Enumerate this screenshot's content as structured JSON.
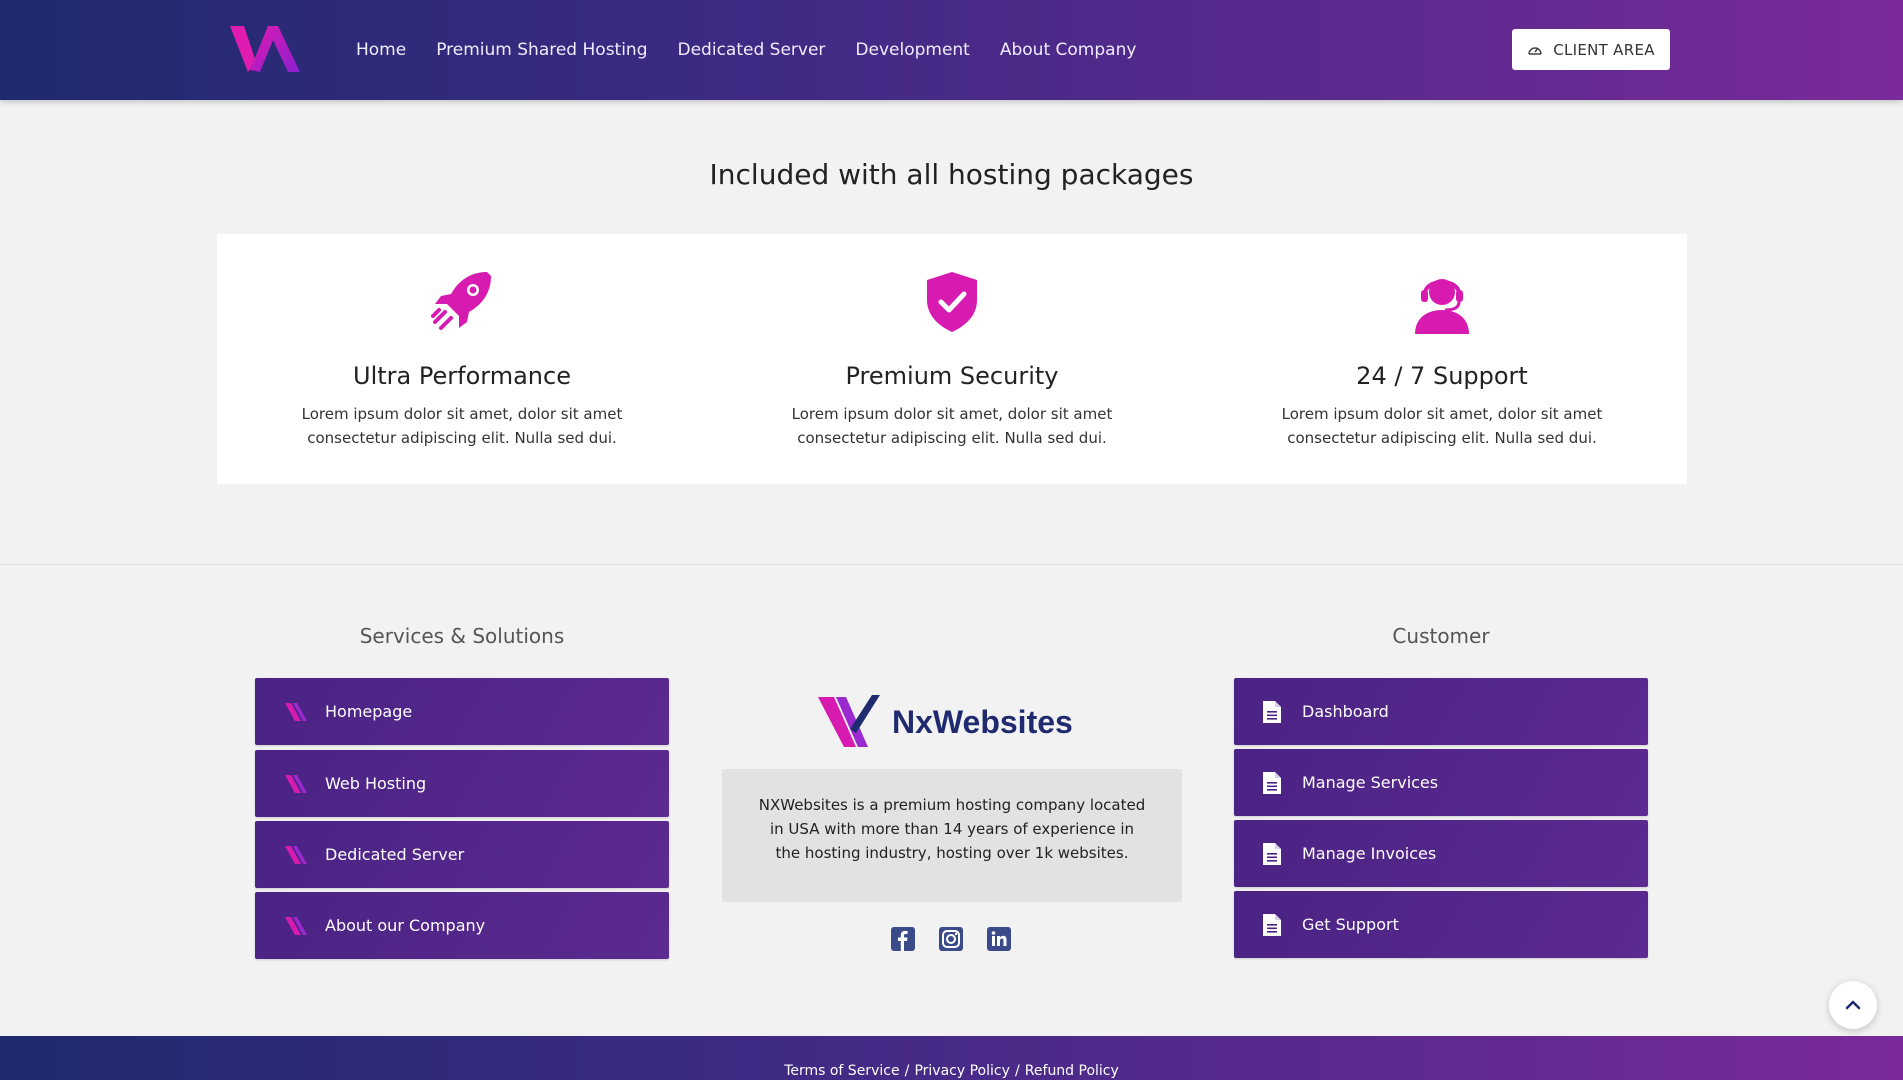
{
  "header": {
    "nav": [
      "Home",
      "Premium Shared Hosting",
      "Dedicated Server",
      "Development",
      "About Company"
    ],
    "client_area_label": "CLIENT AREA"
  },
  "section": {
    "title": "Included with all hosting packages"
  },
  "features": [
    {
      "icon": "rocket-icon",
      "title": "Ultra Performance",
      "text": "Lorem ipsum dolor sit amet, dolor sit amet consectetur adipiscing elit. Nulla sed dui."
    },
    {
      "icon": "shield-check-icon",
      "title": "Premium Security",
      "text": "Lorem ipsum dolor sit amet, dolor sit amet consectetur adipiscing elit. Nulla sed dui."
    },
    {
      "icon": "headset-icon",
      "title": "24 / 7 Support",
      "text": "Lorem ipsum dolor sit amet, dolor sit amet consectetur adipiscing elit. Nulla sed dui."
    }
  ],
  "footer": {
    "services_title": "Services & Solutions",
    "services": [
      "Homepage",
      "Web Hosting",
      "Dedicated Server",
      "About our Company"
    ],
    "customer_title": "Customer",
    "customer": [
      "Dashboard",
      "Manage Services",
      "Manage Invoices",
      "Get Support"
    ],
    "brand_name": "NxWebsites",
    "about": "NXWebsites is a premium hosting company located in USA with more than 14 years of experience in the hosting industry, hosting over 1k websites.",
    "socials": [
      "facebook-icon",
      "instagram-icon",
      "linkedin-icon"
    ]
  },
  "bottom_links": {
    "terms": "Terms of Service",
    "privacy": "Privacy Policy",
    "refund": "Refund Policy",
    "separator": "/"
  },
  "colors": {
    "accent": "#d81bb0",
    "purple": "#4a2384",
    "navy": "#1f2b6e"
  }
}
